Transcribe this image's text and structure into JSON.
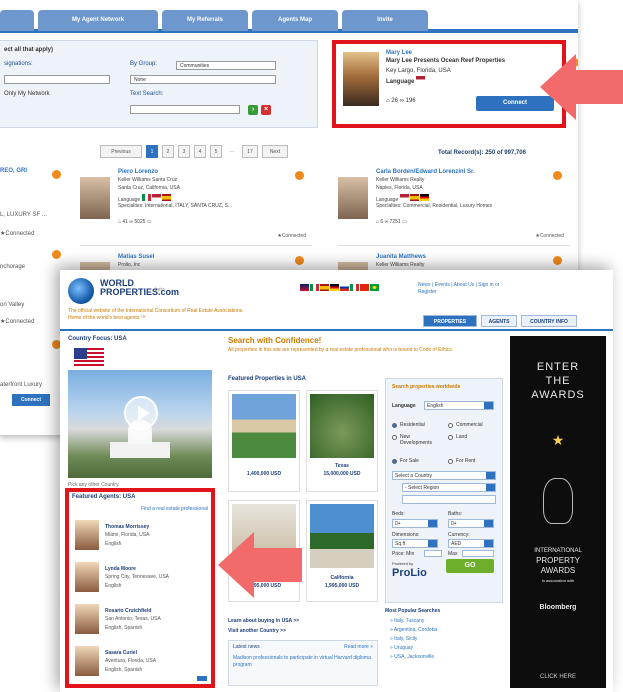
{
  "back": {
    "tabs": [
      "My Agent Network",
      "My Referrals",
      "Agents Map",
      "Invite"
    ],
    "filter": {
      "select_all": "ect all that apply)",
      "designations": "signations:",
      "by_group": "By Group:",
      "group_value": "Communities",
      "group_value2": "None",
      "only_network": "Only My Network",
      "text_search": "Text Search:"
    },
    "profile_card": {
      "name": "Mary Lee",
      "company": "Mary Lee Presents Ocean Reef Properties",
      "location": "Key Largo, Florida, USA",
      "language_label": "Language",
      "stat1": "26",
      "stat2": "196",
      "connect_label": "Connect"
    },
    "pager": {
      "prev": "Previous",
      "pages": [
        "1",
        "2",
        "3",
        "4",
        "5"
      ],
      "ellipsis": "...",
      "last": "17",
      "next": "Next"
    },
    "records": "Total Record(s): 250 of 997,706",
    "left_text": [
      "REO, GRI",
      "L, LUXURY SF ...",
      "nchorage",
      "on Valley",
      "aterfront Luxury"
    ],
    "left_connected": "Connected",
    "left_connect": "Connect",
    "agents": [
      {
        "name": "Piero Lorenzo",
        "office": "Keller Williams Santa Cruz",
        "city": "Santa Cruz, California, USA",
        "lang": "Language",
        "spec": "Specialties: International, ITALY, SANTA CRUZ, S...",
        "s1": "41",
        "s2": "5025",
        "conn": "Connected"
      },
      {
        "name": "Carla Borden/Edward Lorenzini Sr.",
        "office": "Keller Williams Realty",
        "city": "Naples, Florida, USA",
        "lang": "Language",
        "spec": "Specialties: Commercial, Residential, Luxury Homes",
        "s1": "6",
        "s2": "7251",
        "conn": "Connected"
      },
      {
        "name": "Matias Susel",
        "office": "Prolio, Inc",
        "city": "",
        "lang": "",
        "spec": "",
        "s1": "",
        "s2": "",
        "conn": ""
      },
      {
        "name": "Juanita Matthews",
        "office": "Keller Williams Realty",
        "city": "",
        "lang": "",
        "spec": "",
        "s1": "",
        "s2": "",
        "conn": ""
      }
    ]
  },
  "front": {
    "brand1": "WORLD",
    "brand2": "PROPERTIES.com",
    "beta": "beta",
    "tagline1": "The official website of the International Consortium of Real Estate Associations.",
    "tagline2": "Home of the world's best agents.™",
    "toplinks1": "News | Events | About Us | Sign in or",
    "toplinks2": "Register",
    "nav": [
      "PROPERTIES",
      "AGENTS",
      "COUNTRY INFO"
    ],
    "country_focus": "Country Focus: USA",
    "video_caption": "Pick any other Country.",
    "featured_agents_title": "Featured Agents: USA",
    "find_agent": "Find a real estate professional",
    "featured_agents": [
      {
        "name": "Thomas Morrissey",
        "city": "Miami, Florida, USA",
        "lang": "English"
      },
      {
        "name": "Lynda Moore",
        "city": "Spring City, Tennessee, USA",
        "lang": "English"
      },
      {
        "name": "Rosario Crutchfield",
        "city": "San Antonio, Texas, USA",
        "lang": "English, Spanish"
      },
      {
        "name": "Sasara Curiel",
        "city": "Aventura, Florida, USA",
        "lang": "English, Spanish"
      }
    ],
    "swc_title": "Search with Confidence!",
    "swc_sub": "All properties in this site are represented by a real estate professional who is bound to Code of Ethics.",
    "featured_props_title": "Featured Properties in USA",
    "props": [
      {
        "loc": "",
        "price": "1,400,000 USD"
      },
      {
        "loc": "Texas",
        "price": "15,000,000 USD"
      },
      {
        "loc": "",
        "price": "2,995,000 USD"
      },
      {
        "loc": "California",
        "price": "1,995,000 USD"
      }
    ],
    "learn1": "Learn about buying in USA >>",
    "learn2": "Visit another Country >>",
    "latest_news": "Latest news",
    "read_more": "Read more »",
    "news_text": "Madison professionals to participate in virtual Harvard diploma program",
    "search": {
      "title": "Search properties worldwide",
      "language_label": "Language",
      "language_value": "English",
      "types": [
        "Residential",
        "Commercial",
        "New Developments",
        "Land"
      ],
      "sale": "For Sale",
      "rent": "For Rent",
      "country_placeholder": "Select a Country",
      "region_placeholder": "- Select Region",
      "beds": "Beds:",
      "baths": "Baths:",
      "beds_val": "0+",
      "baths_val": "0+",
      "dimensions": "Dimensions:",
      "currency": "Currency:",
      "dim_val": "Sq.ft",
      "cur_val": "AED",
      "price": "Price: Min",
      "max": "Max",
      "powered": "Powered by",
      "prolio": "ProLio",
      "go": "GO"
    },
    "most_popular": "Most Popular Searches",
    "popular": [
      "» Italy, Tuscany",
      "» Argentina, Cordoba",
      "» Italy, Sicily",
      "» Uruguay",
      "» USA, Jacksonville"
    ],
    "ad": {
      "top1": "ENTER",
      "top2": "THE",
      "top3": "AWARDS",
      "star": "★",
      "mid1": "INTERNATIONAL",
      "mid2": "PROPERTY",
      "mid3": "AWARDS",
      "assoc": "in association with",
      "bloomberg": "Bloomberg",
      "click": "CLICK HERE"
    }
  },
  "colors": {
    "accent": "#2e72bf",
    "highlight": "#e2141a",
    "arrow": "#f26a6a"
  }
}
